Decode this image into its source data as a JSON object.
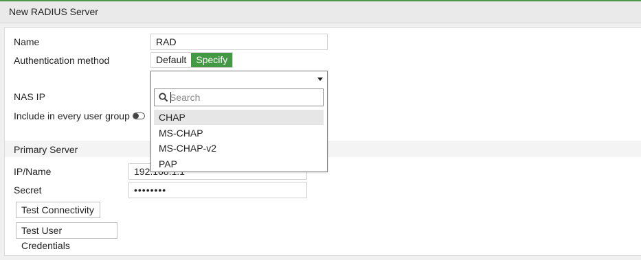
{
  "window": {
    "title": "New RADIUS Server"
  },
  "form": {
    "name_label": "Name",
    "name_value": "RAD",
    "auth_label": "Authentication method",
    "auth_options": [
      "Default",
      "Specify"
    ],
    "auth_selected": "Specify",
    "nas_ip_label": "NAS IP",
    "include_label": "Include in every user group",
    "include_enabled": false
  },
  "primary": {
    "section_title": "Primary Server",
    "ip_label": "IP/Name",
    "ip_value": "192.168.1.1",
    "secret_label": "Secret",
    "secret_value": "••••••••",
    "test_connectivity": "Test Connectivity",
    "test_credentials": "Test User Credentials"
  },
  "dropdown": {
    "search_placeholder": "Search",
    "options": [
      "CHAP",
      "MS-CHAP",
      "MS-CHAP-v2",
      "PAP"
    ],
    "highlighted": "CHAP"
  },
  "colors": {
    "accent": "#449a44",
    "top_border": "#4a9a4a"
  }
}
